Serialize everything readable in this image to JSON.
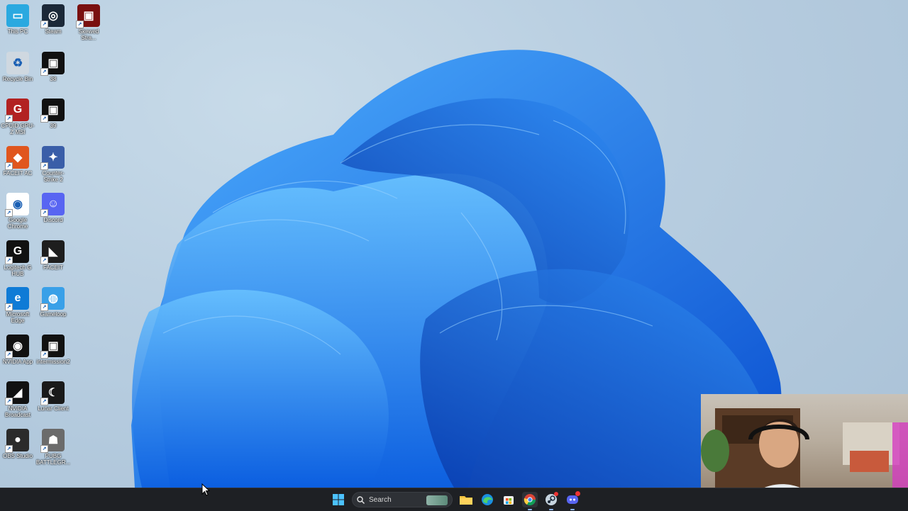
{
  "desktop": {
    "icons": [
      {
        "label": "This PC",
        "icon": "monitor-icon",
        "color": "#2aa9e0"
      },
      {
        "label": "Steam",
        "icon": "steam-icon",
        "color": "#1b2838"
      },
      {
        "label": "Skewed Stra...",
        "icon": "video-file-icon",
        "color": "#7a1010"
      },
      {
        "label": "Recycle Bin",
        "icon": "recycle-bin-icon",
        "color": "#cfd8e0"
      },
      {
        "label": "38",
        "icon": "video-file-icon",
        "color": "#111111"
      },
      {
        "label": "CPUID GPU-Z MSI",
        "icon": "gpuz-icon",
        "color": "#b22222"
      },
      {
        "label": "39",
        "icon": "video-file-icon",
        "color": "#111111"
      },
      {
        "label": "FACEIT AC",
        "icon": "faceit-ac-icon",
        "color": "#e0561e"
      },
      {
        "label": "Counter-Strike 2",
        "icon": "cs2-icon",
        "color": "#3a5ea8"
      },
      {
        "label": "Google Chrome",
        "icon": "chrome-icon",
        "color": "#ffffff"
      },
      {
        "label": "Discord",
        "icon": "discord-icon",
        "color": "#5865f2"
      },
      {
        "label": "Logitech G HUB",
        "icon": "logitech-icon",
        "color": "#111111"
      },
      {
        "label": "FACEIT",
        "icon": "faceit-icon",
        "color": "#1e1e1e"
      },
      {
        "label": "Microsoft Edge",
        "icon": "edge-icon",
        "color": "#0f7bd6"
      },
      {
        "label": "Gameloop",
        "icon": "gameloop-icon",
        "color": "#39a0e8"
      },
      {
        "label": "NVIDIA App",
        "icon": "nvidia-icon",
        "color": "#111111"
      },
      {
        "label": "intermission2",
        "icon": "video-file-icon",
        "color": "#111111"
      },
      {
        "label": "NVIDIA Broadcast",
        "icon": "nvidia-broadcast-icon",
        "color": "#111111"
      },
      {
        "label": "Lunar Client",
        "icon": "lunar-client-icon",
        "color": "#1a1a1a"
      },
      {
        "label": "OBS Studio",
        "icon": "obs-icon",
        "color": "#2b2b2b"
      },
      {
        "label": "PUBG BATTLEGR...",
        "icon": "pubg-icon",
        "color": "#6b6b6b"
      }
    ]
  },
  "taskbar": {
    "search_placeholder": "Search",
    "pinned": [
      {
        "name": "start-icon"
      },
      {
        "name": "file-explorer-icon"
      },
      {
        "name": "edge-icon"
      },
      {
        "name": "store-icon"
      },
      {
        "name": "chrome-icon"
      },
      {
        "name": "steam-icon"
      },
      {
        "name": "discord-icon"
      }
    ]
  },
  "colors": {
    "taskbar": "#1e2024",
    "accent": "#0f6fde"
  }
}
